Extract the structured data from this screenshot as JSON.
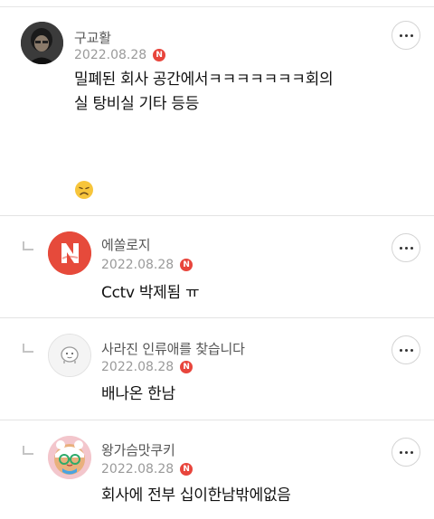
{
  "comments": [
    {
      "author": "구교활",
      "date": "2022.08.28",
      "badge": "N",
      "text": "밀폐된 회사 공간에서ㅋㅋㅋㅋㅋㅋㅋ회의실 탕비실 기타 등등",
      "emoji": "😞",
      "is_reply": false
    },
    {
      "author": "에쏠로지",
      "date": "2022.08.28",
      "badge": "N",
      "text": "Cctv 박제됨 ㅠ",
      "avatar_letter": "N",
      "is_reply": true
    },
    {
      "author": "사라진 인류애를 찾습니다",
      "date": "2022.08.28",
      "badge": "N",
      "text": "배나온 한남",
      "is_reply": true
    },
    {
      "author": "왕가슴맛쿠키",
      "date": "2022.08.28",
      "badge": "N",
      "text": "회사에 전부 십이한남밖에없음",
      "is_reply": true
    }
  ],
  "colors": {
    "badge": "#e8453c",
    "avatar_n": "#e64a3b",
    "divider": "#e3e3e3"
  },
  "icons": [
    "more-options-icon",
    "reply-arrow-icon",
    "new-badge-icon",
    "sad-face-emoji"
  ]
}
